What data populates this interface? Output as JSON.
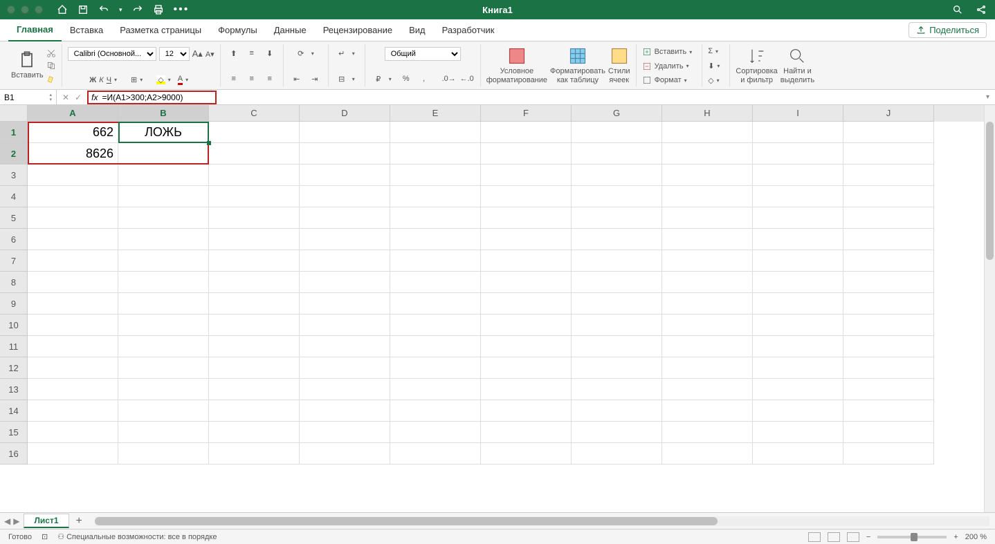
{
  "title": "Книга1",
  "tabs": [
    "Главная",
    "Вставка",
    "Разметка страницы",
    "Формулы",
    "Данные",
    "Рецензирование",
    "Вид",
    "Разработчик"
  ],
  "share": "Поделиться",
  "ribbon": {
    "paste": "Вставить",
    "font_name": "Calibri (Основной...",
    "font_size": "12",
    "bold": "Ж",
    "italic": "К",
    "underline": "Ч",
    "number_format": "Общий",
    "cond_format": "Условное\nформатирование",
    "table_format": "Форматировать\nкак таблицу",
    "cell_styles": "Стили\nячеек",
    "insert": "Вставить",
    "delete": "Удалить",
    "format": "Формат",
    "sort": "Сортировка\nи фильтр",
    "find": "Найти и\nвыделить"
  },
  "name_box": "B1",
  "formula": "=И(A1>300;A2>9000)",
  "columns": [
    "A",
    "B",
    "C",
    "D",
    "E",
    "F",
    "G",
    "H",
    "I",
    "J"
  ],
  "rows_count": 16,
  "cells": {
    "A1": "662",
    "A2": "8626",
    "B1": "ЛОЖЬ"
  },
  "sheet": "Лист1",
  "status": {
    "ready": "Готово",
    "access": "Специальные возможности: все в порядке",
    "zoom": "200 %"
  }
}
